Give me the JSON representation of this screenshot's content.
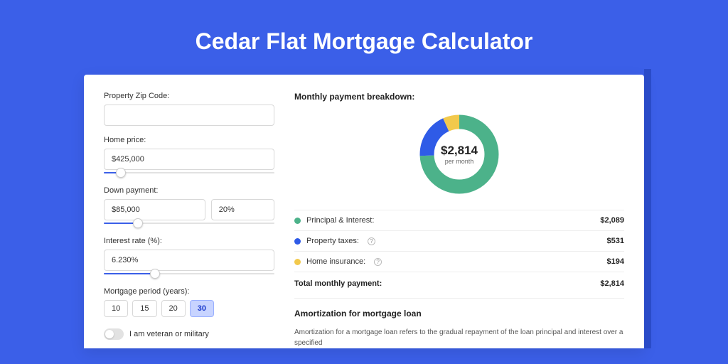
{
  "title": "Cedar Flat Mortgage Calculator",
  "form": {
    "zip_label": "Property Zip Code:",
    "zip_value": "",
    "home_price_label": "Home price:",
    "home_price_value": "$425,000",
    "home_price_slider_pct": 10,
    "down_payment_label": "Down payment:",
    "down_payment_value": "$85,000",
    "down_payment_pct": "20%",
    "down_payment_slider_pct": 20,
    "interest_label": "Interest rate (%):",
    "interest_value": "6.230%",
    "interest_slider_pct": 30,
    "period_label": "Mortgage period (years):",
    "periods": [
      "10",
      "15",
      "20",
      "30"
    ],
    "period_selected_index": 3,
    "veteran_label": "I am veteran or military"
  },
  "breakdown": {
    "title": "Monthly payment breakdown:",
    "center_amount": "$2,814",
    "center_sub": "per month",
    "items": [
      {
        "label": "Principal & Interest:",
        "value": "$2,089",
        "color": "green",
        "help": false
      },
      {
        "label": "Property taxes:",
        "value": "$531",
        "color": "blue",
        "help": true
      },
      {
        "label": "Home insurance:",
        "value": "$194",
        "color": "yellow",
        "help": true
      }
    ],
    "total_label": "Total monthly payment:",
    "total_value": "$2,814"
  },
  "amort": {
    "title": "Amortization for mortgage loan",
    "text": "Amortization for a mortgage loan refers to the gradual repayment of the loan principal and interest over a specified"
  },
  "chart_data": {
    "type": "pie",
    "title": "Monthly payment breakdown",
    "series": [
      {
        "name": "Principal & Interest",
        "value": 2089,
        "color": "#4cb28a"
      },
      {
        "name": "Property taxes",
        "value": 531,
        "color": "#2f5be7"
      },
      {
        "name": "Home insurance",
        "value": 194,
        "color": "#f2c94c"
      }
    ],
    "total": 2814
  }
}
